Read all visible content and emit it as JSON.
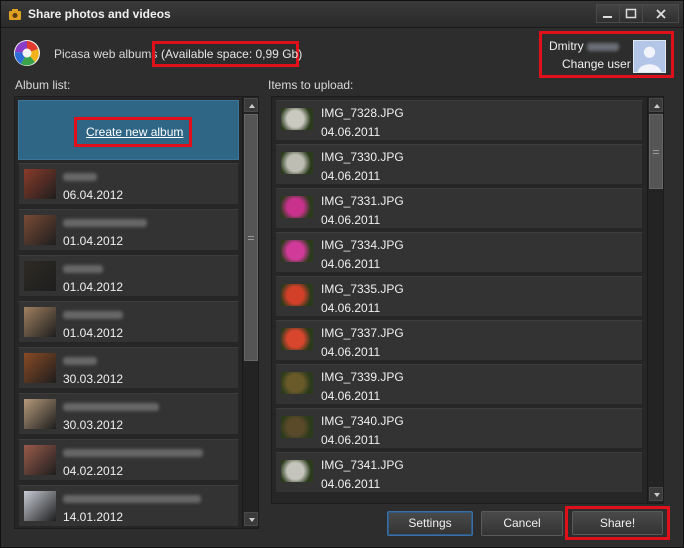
{
  "window": {
    "title": "Share photos and videos",
    "icons": {
      "app": "camera-app-icon",
      "minimize": "minimize-icon",
      "maximize": "maximize-icon",
      "close": "close-icon"
    }
  },
  "header": {
    "service_name": "Picasa web albums",
    "available_space": "(Available space: 0,99 Gb)",
    "logo_icon": "picasa-logo-icon"
  },
  "user": {
    "name": "Dmitry",
    "change_user_label": "Change user",
    "avatar_icon": "user-avatar-icon"
  },
  "albums": {
    "label": "Album list:",
    "create_label": "Create new album",
    "items": [
      {
        "date": "06.04.2012",
        "thumb_color": "#8a3b2a"
      },
      {
        "date": "01.04.2012",
        "thumb_color": "#7a4a36"
      },
      {
        "date": "01.04.2012",
        "thumb_color": "#2e2a24"
      },
      {
        "date": "01.04.2012",
        "thumb_color": "#a08060"
      },
      {
        "date": "30.03.2012",
        "thumb_color": "#8a4a24"
      },
      {
        "date": "30.03.2012",
        "thumb_color": "#b59a7a"
      },
      {
        "date": "04.02.2012",
        "thumb_color": "#9a5a4a"
      },
      {
        "date": "14.01.2012",
        "thumb_color": "#c8ccd4"
      }
    ]
  },
  "uploads": {
    "label": "Items to upload:",
    "items": [
      {
        "name": "IMG_7328.JPG",
        "date": "04.06.2011",
        "thumb_color": "#c9c9c0"
      },
      {
        "name": "IMG_7330.JPG",
        "date": "04.06.2011",
        "thumb_color": "#bdbdb4"
      },
      {
        "name": "IMG_7331.JPG",
        "date": "04.06.2011",
        "thumb_color": "#c8328c"
      },
      {
        "name": "IMG_7334.JPG",
        "date": "04.06.2011",
        "thumb_color": "#d23a9a"
      },
      {
        "name": "IMG_7335.JPG",
        "date": "04.06.2011",
        "thumb_color": "#d2402a"
      },
      {
        "name": "IMG_7337.JPG",
        "date": "04.06.2011",
        "thumb_color": "#d8462e"
      },
      {
        "name": "IMG_7339.JPG",
        "date": "04.06.2011",
        "thumb_color": "#6a5a2a"
      },
      {
        "name": "IMG_7340.JPG",
        "date": "04.06.2011",
        "thumb_color": "#5a4a2a"
      },
      {
        "name": "IMG_7341.JPG",
        "date": "04.06.2011",
        "thumb_color": "#c4c4bc"
      }
    ]
  },
  "actions": {
    "settings_label": "Settings",
    "cancel_label": "Cancel",
    "share_label": "Share!"
  }
}
